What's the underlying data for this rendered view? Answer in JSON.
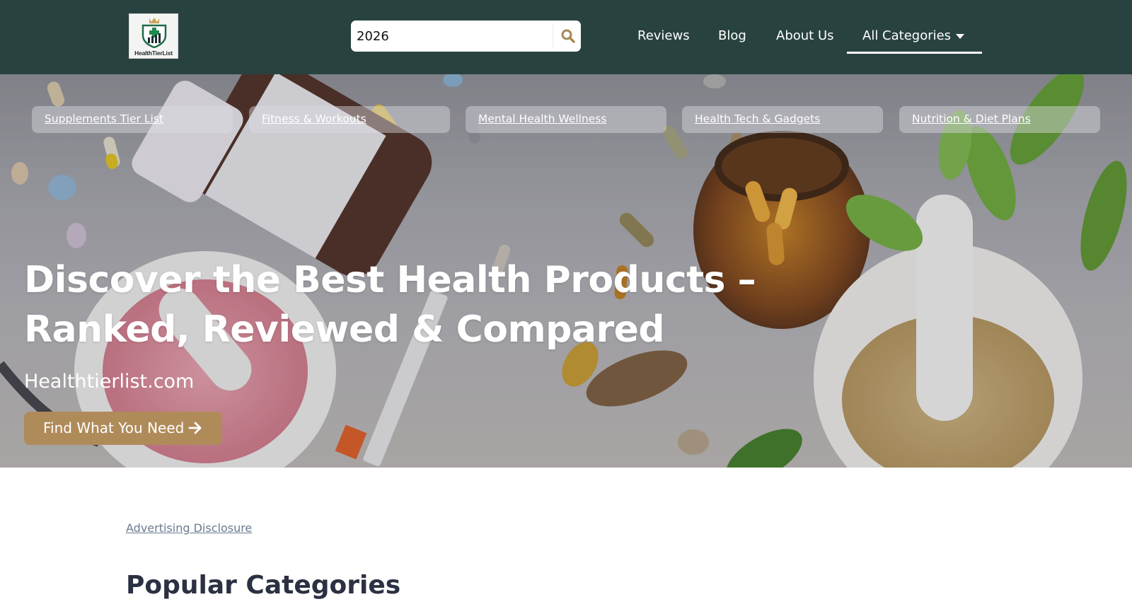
{
  "header": {
    "logo_text": "HealthTierList",
    "search": {
      "value": "2026",
      "icon": "search-icon"
    },
    "nav": [
      {
        "label": "Reviews"
      },
      {
        "label": "Blog"
      },
      {
        "label": "About Us"
      }
    ],
    "categories_label": "All Categories",
    "categories_icon": "caret-down-icon"
  },
  "hero": {
    "category_links": [
      {
        "label": "Supplements Tier List"
      },
      {
        "label": "Fitness & Workouts"
      },
      {
        "label": "Mental Health Wellness"
      },
      {
        "label": "Health Tech & Gadgets"
      },
      {
        "label": "Nutrition & Diet Plans"
      }
    ],
    "title": "Discover the Best Health Products – Ranked, Reviewed & Compared",
    "subtitle": "Healthtierlist.com",
    "cta_label": "Find What You Need",
    "cta_icon": "arrow-right-icon"
  },
  "main": {
    "disclosure": "Advertising Disclosure",
    "section_title": "Popular Categories"
  },
  "colors": {
    "header_bg": "#284240",
    "accent": "#b08b5a",
    "heading": "#2b3142",
    "link_muted": "#6b7a90"
  }
}
